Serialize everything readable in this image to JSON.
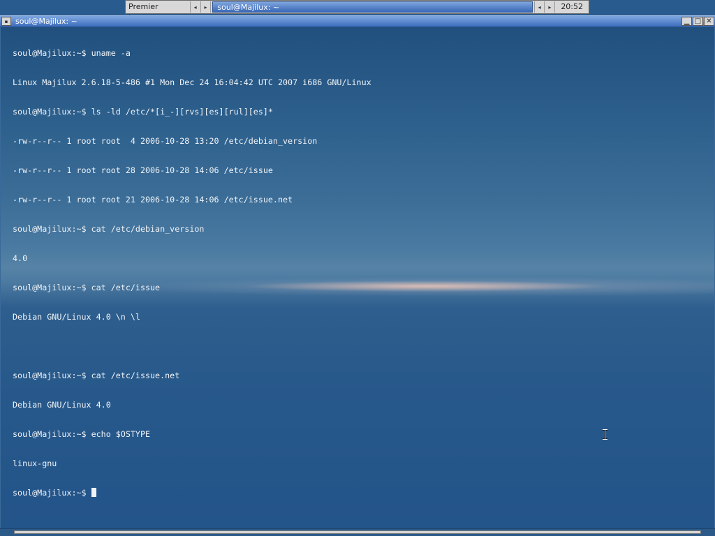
{
  "panel": {
    "desktop_name": "Premier bureau",
    "prev_arrow": "◂",
    "next_arrow": "▸",
    "task_title": "soul@Majilux: ~",
    "clock": "20:52"
  },
  "window": {
    "title": "soul@Majilux: ~",
    "menu_glyph": "▪",
    "minimize_glyph": "▁",
    "maximize_glyph": "□",
    "close_glyph": "✕"
  },
  "terminal": {
    "lines": [
      "soul@Majilux:~$ uname -a",
      "Linux Majilux 2.6.18-5-486 #1 Mon Dec 24 16:04:42 UTC 2007 i686 GNU/Linux",
      "soul@Majilux:~$ ls -ld /etc/*[i_-][rvs][es][rul][es]*",
      "-rw-r--r-- 1 root root  4 2006-10-28 13:20 /etc/debian_version",
      "-rw-r--r-- 1 root root 28 2006-10-28 14:06 /etc/issue",
      "-rw-r--r-- 1 root root 21 2006-10-28 14:06 /etc/issue.net",
      "soul@Majilux:~$ cat /etc/debian_version",
      "4.0",
      "soul@Majilux:~$ cat /etc/issue",
      "Debian GNU/Linux 4.0 \\n \\l",
      "",
      "soul@Majilux:~$ cat /etc/issue.net",
      "Debian GNU/Linux 4.0",
      "soul@Majilux:~$ echo $OSTYPE",
      "linux-gnu"
    ],
    "prompt": "soul@Majilux:~$ "
  },
  "colors": {
    "terminal_text": "#f0f4f8",
    "titlebar_accent": "#3d6dbd"
  }
}
